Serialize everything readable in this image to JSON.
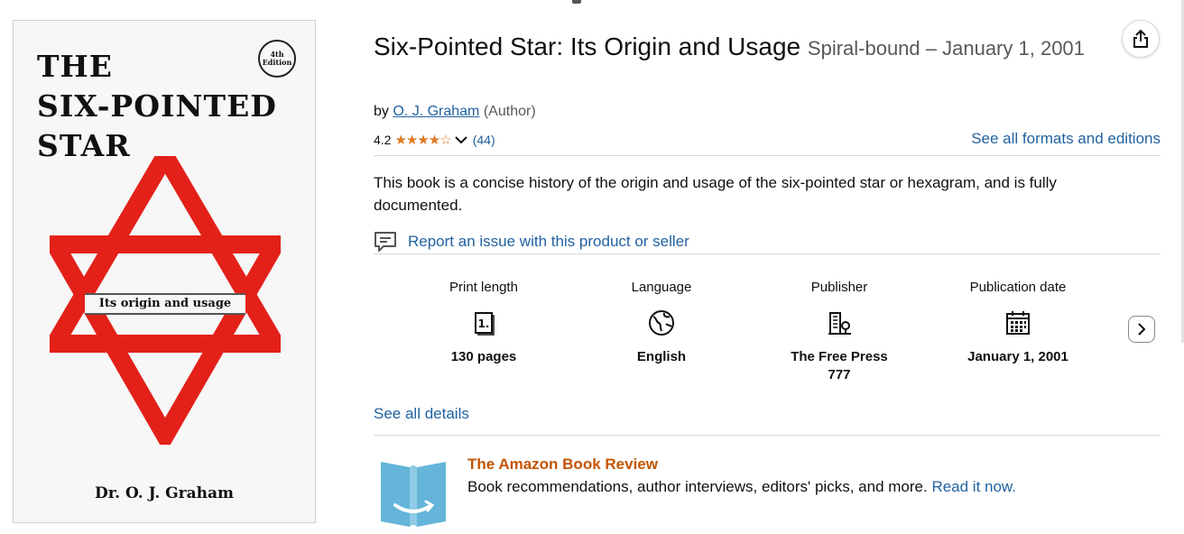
{
  "cover": {
    "title_line1": "THE",
    "title_line2": "SIX-POINTED",
    "title_line3": "STAR",
    "edition_line1": "4th",
    "edition_line2": "Edition",
    "subtitle": "Its origin and usage",
    "author": "Dr. O. J. Graham",
    "star_color": "#e32119"
  },
  "product": {
    "title": "Six-Pointed Star: Its Origin and Usage",
    "format": "Spiral-bound – January 1, 2001",
    "by": "by",
    "author": "O. J. Graham",
    "author_role": "(Author)",
    "rating": "4.2",
    "rating_count": "(44)",
    "see_all_formats": "See all formats and editions",
    "description": "This book is a concise history of the origin and usage of the six-pointed star or hexagram, and is fully documented.",
    "report_issue": "Report an issue with this product or seller"
  },
  "details": [
    {
      "label": "Print length",
      "icon": "book-pages-icon",
      "value": "130 pages"
    },
    {
      "label": "Language",
      "icon": "globe-icon",
      "value": "English"
    },
    {
      "label": "Publisher",
      "icon": "building-icon",
      "value": "The Free Press 777"
    },
    {
      "label": "Publication date",
      "icon": "calendar-icon",
      "value": "January 1, 2001"
    }
  ],
  "see_all_details": "See all details",
  "book_review": {
    "title": "The Amazon Book Review",
    "text": "Book recommendations, author interviews, editors' picks, and more.",
    "link": "Read it now."
  },
  "colors": {
    "link": "#2162a1",
    "star": "#de7921",
    "review_title": "#c45500"
  }
}
